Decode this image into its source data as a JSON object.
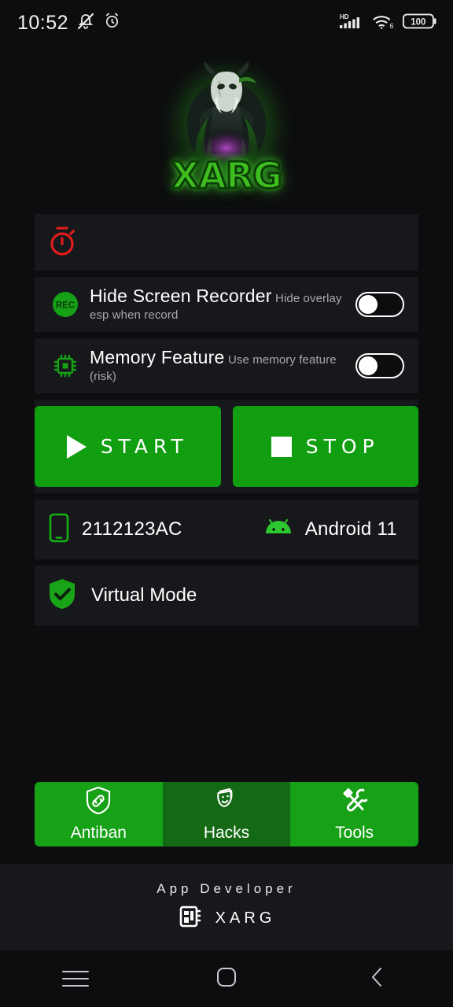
{
  "status_bar": {
    "time": "10:52",
    "icons_left": [
      "mute-icon",
      "alarm-icon"
    ],
    "network_label": "HD",
    "wifi_generation": "6",
    "battery_level": "100"
  },
  "logo": {
    "brand_text": "XARG",
    "figure": "predator-mascot",
    "glow_color": "#3fbe20"
  },
  "timer_card": {
    "icon": "stopwatch-icon",
    "icon_color": "#e01b1b",
    "value": ""
  },
  "settings": [
    {
      "icon": "rec-icon",
      "title": "Hide Screen Recorder",
      "subtitle": "Hide overlay esp when record",
      "enabled": false
    },
    {
      "icon": "cpu-chip-icon",
      "title": "Memory Feature",
      "subtitle": "Use memory feature (risk)",
      "enabled": false
    }
  ],
  "actions": {
    "start_label": "START",
    "stop_label": "STOP",
    "button_color": "#119e11"
  },
  "device": {
    "model": "2112123AC",
    "os": "Android 11",
    "phone_icon": "phone-icon",
    "android_icon": "android-icon"
  },
  "virtual_mode": {
    "label": "Virtual Mode",
    "icon": "shield-check-icon",
    "icon_color": "#18a318"
  },
  "tabs": [
    {
      "label": "Antiban",
      "icon": "shield-link-icon",
      "active": true
    },
    {
      "label": "Hacks",
      "icon": "theater-masks-icon",
      "active": false
    },
    {
      "label": "Tools",
      "icon": "tools-icon",
      "active": true
    }
  ],
  "footer": {
    "caption": "App Developer",
    "developer": "XARG",
    "icon": "chip-card-icon"
  },
  "nav_bar": {
    "recents": "menu-icon",
    "home": "home-square-icon",
    "back": "back-chevron-icon"
  },
  "colors": {
    "page_bg": "#0d0d0f",
    "card_bg": "#17181b",
    "accent_green": "#17a117",
    "accent_green_dim": "#146a14",
    "danger_red": "#e01b1b"
  }
}
